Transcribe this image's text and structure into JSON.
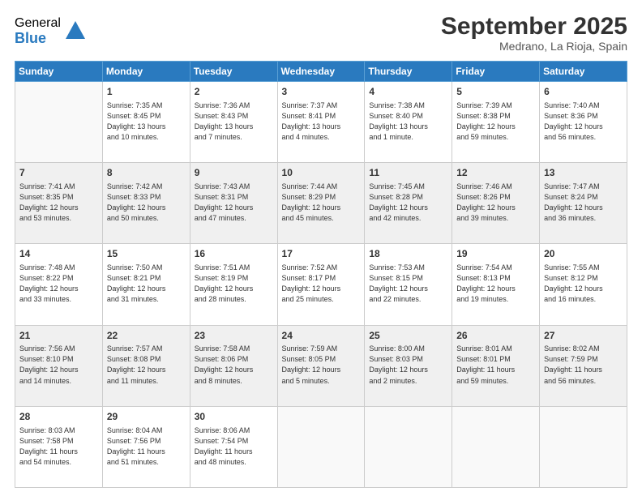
{
  "logo": {
    "general": "General",
    "blue": "Blue"
  },
  "header": {
    "month": "September 2025",
    "location": "Medrano, La Rioja, Spain"
  },
  "weekdays": [
    "Sunday",
    "Monday",
    "Tuesday",
    "Wednesday",
    "Thursday",
    "Friday",
    "Saturday"
  ],
  "weeks": [
    [
      {
        "day": "",
        "info": ""
      },
      {
        "day": "1",
        "info": "Sunrise: 7:35 AM\nSunset: 8:45 PM\nDaylight: 13 hours\nand 10 minutes."
      },
      {
        "day": "2",
        "info": "Sunrise: 7:36 AM\nSunset: 8:43 PM\nDaylight: 13 hours\nand 7 minutes."
      },
      {
        "day": "3",
        "info": "Sunrise: 7:37 AM\nSunset: 8:41 PM\nDaylight: 13 hours\nand 4 minutes."
      },
      {
        "day": "4",
        "info": "Sunrise: 7:38 AM\nSunset: 8:40 PM\nDaylight: 13 hours\nand 1 minute."
      },
      {
        "day": "5",
        "info": "Sunrise: 7:39 AM\nSunset: 8:38 PM\nDaylight: 12 hours\nand 59 minutes."
      },
      {
        "day": "6",
        "info": "Sunrise: 7:40 AM\nSunset: 8:36 PM\nDaylight: 12 hours\nand 56 minutes."
      }
    ],
    [
      {
        "day": "7",
        "info": "Sunrise: 7:41 AM\nSunset: 8:35 PM\nDaylight: 12 hours\nand 53 minutes."
      },
      {
        "day": "8",
        "info": "Sunrise: 7:42 AM\nSunset: 8:33 PM\nDaylight: 12 hours\nand 50 minutes."
      },
      {
        "day": "9",
        "info": "Sunrise: 7:43 AM\nSunset: 8:31 PM\nDaylight: 12 hours\nand 47 minutes."
      },
      {
        "day": "10",
        "info": "Sunrise: 7:44 AM\nSunset: 8:29 PM\nDaylight: 12 hours\nand 45 minutes."
      },
      {
        "day": "11",
        "info": "Sunrise: 7:45 AM\nSunset: 8:28 PM\nDaylight: 12 hours\nand 42 minutes."
      },
      {
        "day": "12",
        "info": "Sunrise: 7:46 AM\nSunset: 8:26 PM\nDaylight: 12 hours\nand 39 minutes."
      },
      {
        "day": "13",
        "info": "Sunrise: 7:47 AM\nSunset: 8:24 PM\nDaylight: 12 hours\nand 36 minutes."
      }
    ],
    [
      {
        "day": "14",
        "info": "Sunrise: 7:48 AM\nSunset: 8:22 PM\nDaylight: 12 hours\nand 33 minutes."
      },
      {
        "day": "15",
        "info": "Sunrise: 7:50 AM\nSunset: 8:21 PM\nDaylight: 12 hours\nand 31 minutes."
      },
      {
        "day": "16",
        "info": "Sunrise: 7:51 AM\nSunset: 8:19 PM\nDaylight: 12 hours\nand 28 minutes."
      },
      {
        "day": "17",
        "info": "Sunrise: 7:52 AM\nSunset: 8:17 PM\nDaylight: 12 hours\nand 25 minutes."
      },
      {
        "day": "18",
        "info": "Sunrise: 7:53 AM\nSunset: 8:15 PM\nDaylight: 12 hours\nand 22 minutes."
      },
      {
        "day": "19",
        "info": "Sunrise: 7:54 AM\nSunset: 8:13 PM\nDaylight: 12 hours\nand 19 minutes."
      },
      {
        "day": "20",
        "info": "Sunrise: 7:55 AM\nSunset: 8:12 PM\nDaylight: 12 hours\nand 16 minutes."
      }
    ],
    [
      {
        "day": "21",
        "info": "Sunrise: 7:56 AM\nSunset: 8:10 PM\nDaylight: 12 hours\nand 14 minutes."
      },
      {
        "day": "22",
        "info": "Sunrise: 7:57 AM\nSunset: 8:08 PM\nDaylight: 12 hours\nand 11 minutes."
      },
      {
        "day": "23",
        "info": "Sunrise: 7:58 AM\nSunset: 8:06 PM\nDaylight: 12 hours\nand 8 minutes."
      },
      {
        "day": "24",
        "info": "Sunrise: 7:59 AM\nSunset: 8:05 PM\nDaylight: 12 hours\nand 5 minutes."
      },
      {
        "day": "25",
        "info": "Sunrise: 8:00 AM\nSunset: 8:03 PM\nDaylight: 12 hours\nand 2 minutes."
      },
      {
        "day": "26",
        "info": "Sunrise: 8:01 AM\nSunset: 8:01 PM\nDaylight: 11 hours\nand 59 minutes."
      },
      {
        "day": "27",
        "info": "Sunrise: 8:02 AM\nSunset: 7:59 PM\nDaylight: 11 hours\nand 56 minutes."
      }
    ],
    [
      {
        "day": "28",
        "info": "Sunrise: 8:03 AM\nSunset: 7:58 PM\nDaylight: 11 hours\nand 54 minutes."
      },
      {
        "day": "29",
        "info": "Sunrise: 8:04 AM\nSunset: 7:56 PM\nDaylight: 11 hours\nand 51 minutes."
      },
      {
        "day": "30",
        "info": "Sunrise: 8:06 AM\nSunset: 7:54 PM\nDaylight: 11 hours\nand 48 minutes."
      },
      {
        "day": "",
        "info": ""
      },
      {
        "day": "",
        "info": ""
      },
      {
        "day": "",
        "info": ""
      },
      {
        "day": "",
        "info": ""
      }
    ]
  ]
}
